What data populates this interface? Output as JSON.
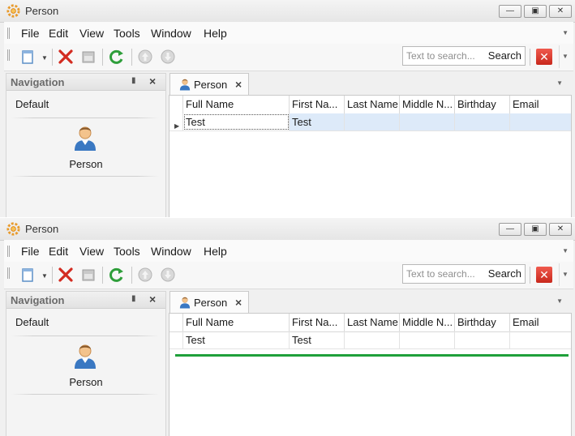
{
  "windows": [
    {
      "title": "Person",
      "menu": [
        "File",
        "Edit",
        "View",
        "Tools",
        "Window",
        "Help"
      ],
      "search_placeholder": "Text to search...",
      "search_button": "Search",
      "nav_title": "Navigation",
      "nav_group": "Default",
      "nav_item": "Person",
      "tab_label": "Person",
      "grid": {
        "columns": [
          "Full Name",
          "First Na...",
          "Last Name",
          "Middle N...",
          "Birthday",
          "Email"
        ],
        "rows": [
          [
            "Test",
            "Test",
            "",
            "",
            "",
            ""
          ]
        ],
        "selected_row": 0
      }
    },
    {
      "title": "Person",
      "menu": [
        "File",
        "Edit",
        "View",
        "Tools",
        "Window",
        "Help"
      ],
      "search_placeholder": "Text to search...",
      "search_button": "Search",
      "nav_title": "Navigation",
      "nav_group": "Default",
      "nav_item": "Person",
      "tab_label": "Person",
      "grid": {
        "columns": [
          "Full Name",
          "First Na...",
          "Last Name",
          "Middle N...",
          "Birthday",
          "Email"
        ],
        "rows": [
          [
            "Test",
            "Test",
            "",
            "",
            "",
            ""
          ]
        ],
        "selected_row": -1
      }
    }
  ],
  "colors": {
    "selection_row": "#ddeaf9",
    "delete_red": "#d32b20",
    "refresh_green": "#2e9e3a",
    "insert_line": "#1fa03a"
  }
}
